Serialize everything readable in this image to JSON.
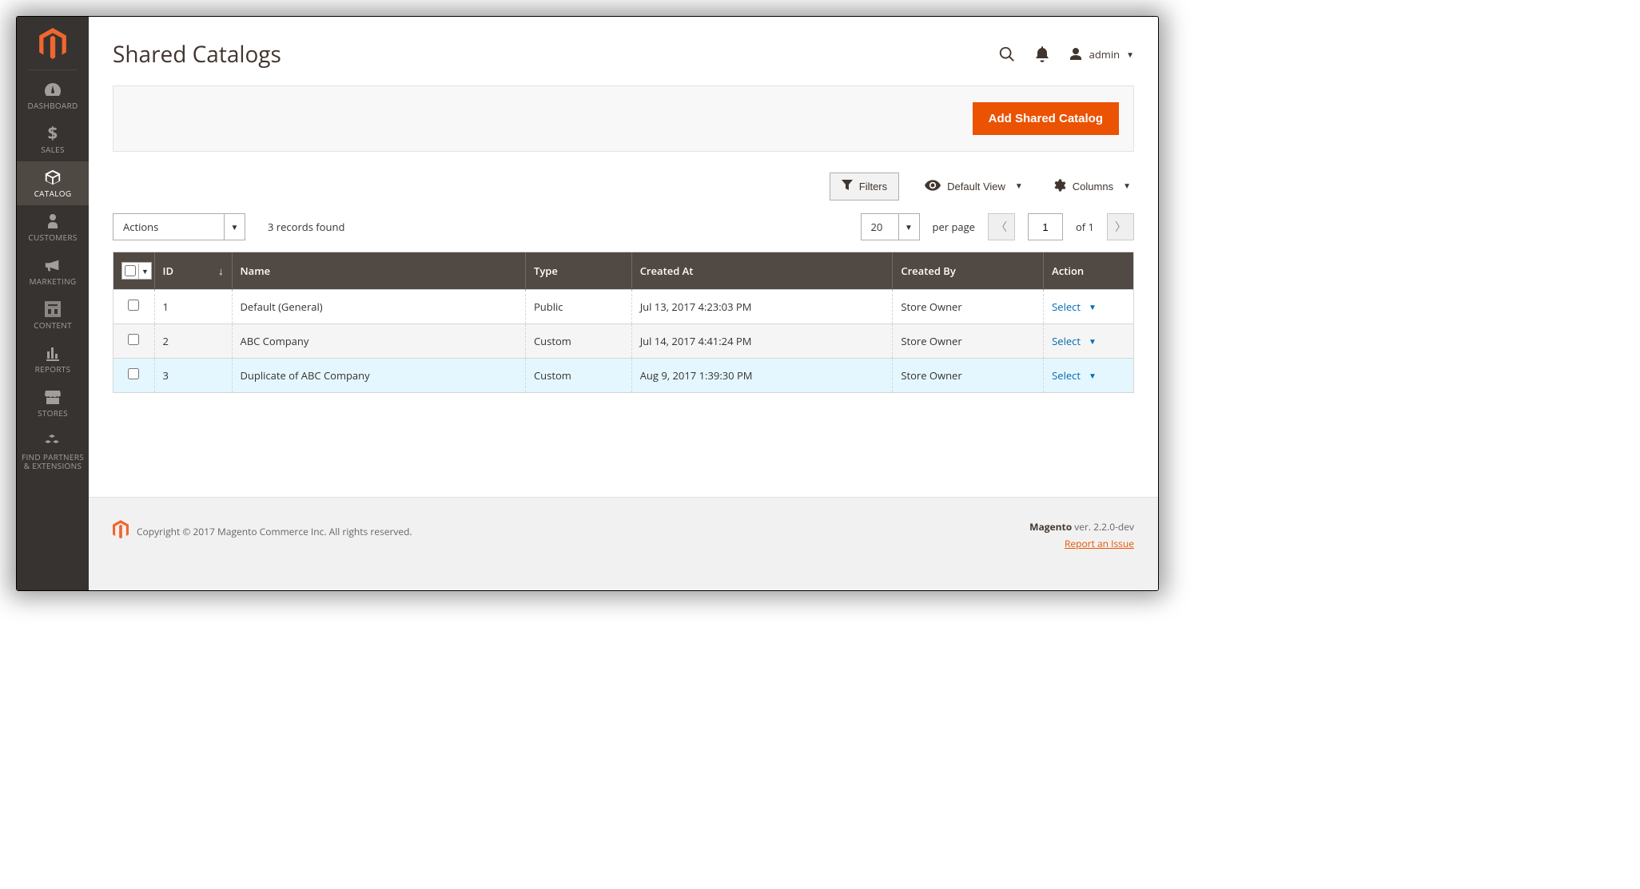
{
  "page_title": "Shared Catalogs",
  "header": {
    "admin_label": "admin"
  },
  "sidebar": {
    "items": [
      {
        "label": "DASHBOARD",
        "name": "sidebar-item-dashboard"
      },
      {
        "label": "SALES",
        "name": "sidebar-item-sales"
      },
      {
        "label": "CATALOG",
        "name": "sidebar-item-catalog"
      },
      {
        "label": "CUSTOMERS",
        "name": "sidebar-item-customers"
      },
      {
        "label": "MARKETING",
        "name": "sidebar-item-marketing"
      },
      {
        "label": "CONTENT",
        "name": "sidebar-item-content"
      },
      {
        "label": "REPORTS",
        "name": "sidebar-item-reports"
      },
      {
        "label": "STORES",
        "name": "sidebar-item-stores"
      },
      {
        "label": "FIND PARTNERS & EXTENSIONS",
        "name": "sidebar-item-partners"
      }
    ]
  },
  "actions": {
    "add_button": "Add Shared Catalog",
    "filters": "Filters",
    "default_view": "Default View",
    "columns": "Columns"
  },
  "toolbar": {
    "actions_label": "Actions",
    "records_found": "3 records found",
    "per_page_value": "20",
    "per_page_label": "per page",
    "current_page": "1",
    "of_label": "of 1"
  },
  "table": {
    "headers": {
      "id": "ID",
      "name": "Name",
      "type": "Type",
      "created_at": "Created At",
      "created_by": "Created By",
      "action": "Action"
    },
    "action_label": "Select",
    "rows": [
      {
        "id": "1",
        "name": "Default (General)",
        "type": "Public",
        "created_at": "Jul 13, 2017 4:23:03 PM",
        "created_by": "Store Owner"
      },
      {
        "id": "2",
        "name": "ABC Company",
        "type": "Custom",
        "created_at": "Jul 14, 2017 4:41:24 PM",
        "created_by": "Store Owner"
      },
      {
        "id": "3",
        "name": "Duplicate of ABC Company",
        "type": "Custom",
        "created_at": "Aug 9, 2017 1:39:30 PM",
        "created_by": "Store Owner"
      }
    ]
  },
  "footer": {
    "copyright": "Copyright © 2017 Magento Commerce Inc. All rights reserved.",
    "brand": "Magento",
    "version": " ver. 2.2.0-dev",
    "report": "Report an Issue"
  }
}
